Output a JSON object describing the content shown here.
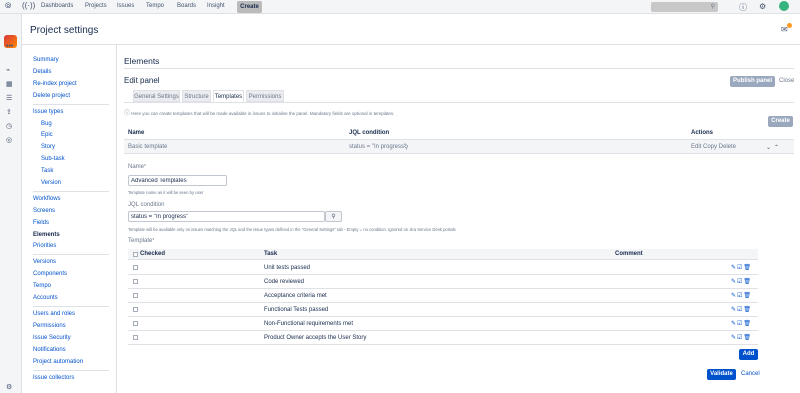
{
  "topnav": {
    "items": [
      "Dashboards",
      "Projects",
      "Issues",
      "Tempo",
      "Boards",
      "Insight"
    ],
    "create_label": "Create"
  },
  "header": {
    "project_title": "Project settings"
  },
  "sidebar": {
    "group1": [
      "Summary",
      "Details",
      "Re-index project",
      "Delete project"
    ],
    "issue_types_label": "Issue types",
    "issue_types": [
      "Bug",
      "Epic",
      "Story",
      "Sub-task",
      "Task",
      "Version"
    ],
    "group2": [
      "Workflows",
      "Screens",
      "Fields",
      "Elements",
      "Priorities"
    ],
    "group3": [
      "Versions",
      "Components",
      "Tempo",
      "Accounts"
    ],
    "group4": [
      "Users and roles",
      "Permissions",
      "Issue Security",
      "Notifications",
      "Project automation"
    ],
    "group5": [
      "Issue collectors"
    ]
  },
  "main": {
    "title": "Elements",
    "edit_panel_title": "Edit panel",
    "publish_label": "Publish panel",
    "close_label": "Close",
    "tabs": [
      "General Settings",
      "Structure",
      "Templates",
      "Permissions"
    ],
    "active_tab": "Templates",
    "info_text": "Here you can create templates that will be made available in issues to initialise the panel. Mandatory fields are optional in templates.",
    "create_label": "Create",
    "templates_table": {
      "headers": [
        "Name",
        "JQL condition",
        "Actions"
      ],
      "rows": [
        {
          "name": "Basic template",
          "jql": "status = \"In progress\"",
          "actions": "Edit Copy Delete"
        }
      ]
    },
    "form": {
      "name_label": "Name",
      "name_value": "Advanced Templates",
      "name_hint": "Template name as it will be seen by user",
      "jql_label": "JQL condition",
      "jql_value": "status = \"In progress\"",
      "jql_hint": "Template will be available only on issues matching the JQL and the issue types defined in the \"General Settings\" tab - Empty = no condition. Ignored on Jira Service Desk portals",
      "template_label": "Template",
      "required_mark": "*"
    },
    "task_table": {
      "headers": [
        "Checked",
        "Task",
        "Comment"
      ],
      "rows": [
        "Unit tests passed",
        "Code reviewed",
        "Acceptance criteria met",
        "Functional Tests passed",
        "Non-Functional requirements met",
        "Product Owner accepts the User Story"
      ]
    },
    "add_label": "Add",
    "validate_label": "Validate",
    "cancel_label": "Cancel"
  }
}
